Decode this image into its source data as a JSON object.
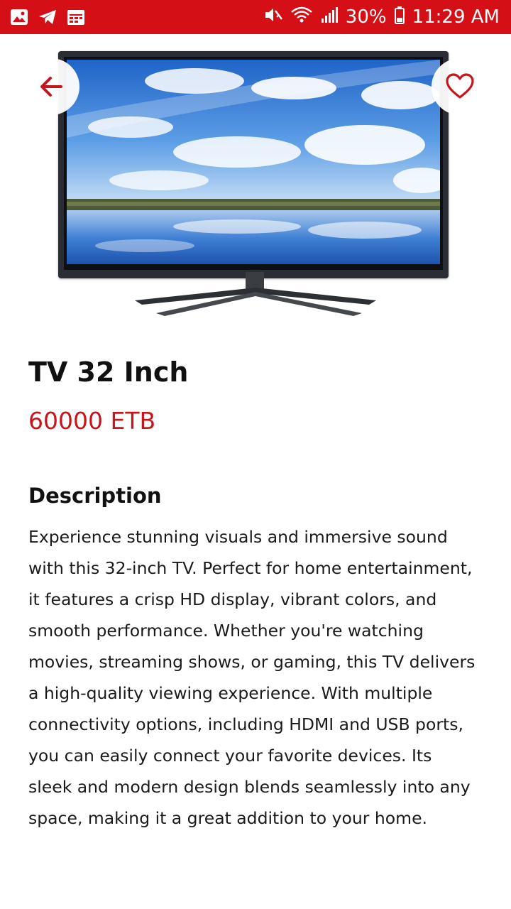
{
  "status_bar": {
    "battery_percent": "30%",
    "time": "11:29 AM"
  },
  "colors": {
    "accent": "#d50f16",
    "price": "#c4161c"
  },
  "hero": {
    "back_icon": "arrow-left-icon",
    "favorite_icon": "heart-outline-icon"
  },
  "product": {
    "title": "TV 32 Inch",
    "price": "60000 ETB",
    "description_heading": "Description",
    "description": "Experience stunning visuals and immersive sound with this 32-inch TV. Perfect for home entertainment, it features a crisp HD display, vibrant colors, and smooth performance. Whether you're watching movies, streaming shows, or gaming, this TV delivers a high-quality viewing experience. With multiple connectivity options, including HDMI and USB ports, you can easily connect your favorite devices. Its sleek and modern design blends seamlessly into any space, making it a great addition to your home."
  }
}
